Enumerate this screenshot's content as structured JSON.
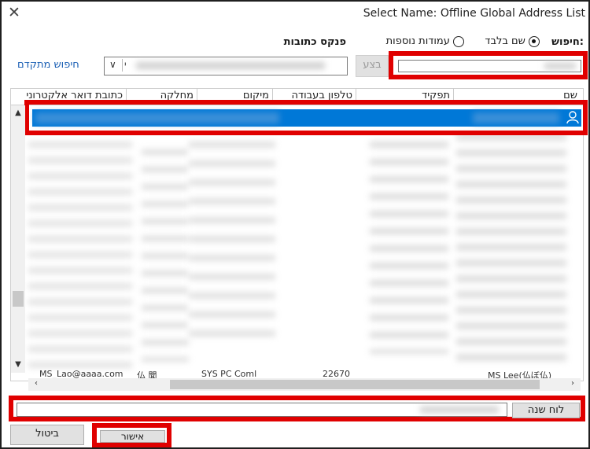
{
  "window": {
    "title": "Select Name: Offline Global Address List",
    "close_glyph": "✕"
  },
  "search": {
    "label": "חיפוש:",
    "option_name_only": "שם בלבד",
    "option_more_columns": "עמודות נוספות",
    "address_book_label": "פנקס כתובות",
    "go_label": "בצע",
    "advanced_label": "חיפוש מתקדם",
    "address_book_value": "י"
  },
  "columns": [
    {
      "label": "שם"
    },
    {
      "label": "תפקיד"
    },
    {
      "label": "טלפון בעבודה"
    },
    {
      "label": "מיקום"
    },
    {
      "label": "מחלקה"
    },
    {
      "label": "כתובת דואר אלקטרוני"
    }
  ],
  "partial_row": {
    "email": "MS_Lao@aaaa.com",
    "misc": "仏 聞",
    "department": "SYS PC Coml",
    "phone": "22670",
    "name": "MS Lee(仏ぼ仏)"
  },
  "recipient": {
    "label": "לוח שנה"
  },
  "footer": {
    "cancel_label": "ביטול",
    "ok_label": "אישור"
  },
  "icons": {
    "user": "person-icon",
    "dropdown": "chevron-down-icon"
  },
  "colors": {
    "selection": "#0078d7",
    "highlight_box": "#e00000",
    "link": "#1a5fb4"
  }
}
